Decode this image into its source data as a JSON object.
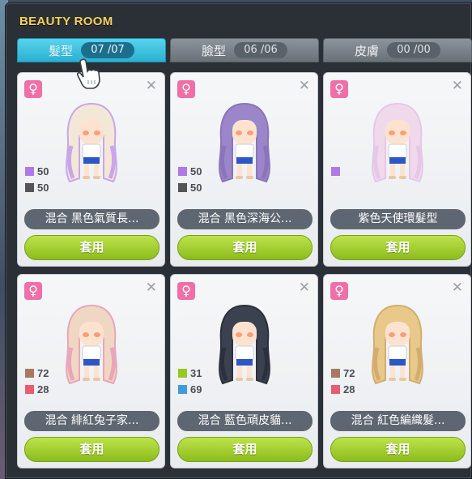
{
  "window": {
    "title": "BEAUTY ROOM"
  },
  "tabs": [
    {
      "label": "髮型",
      "count": "07 /07",
      "active": true
    },
    {
      "label": "臉型",
      "count": "06 /06",
      "active": false
    },
    {
      "label": "皮膚",
      "count": "00 /00",
      "active": false
    }
  ],
  "cards": [
    {
      "gender": "♀",
      "name": "混合 黑色氣質長...",
      "apply": "套用",
      "hair": "#f3e8d8",
      "hair2": "#c9a6ea",
      "mix": [
        {
          "color": "#b07ae6",
          "value": "50"
        },
        {
          "color": "#555555",
          "value": "50"
        }
      ]
    },
    {
      "gender": "♀",
      "name": "混合 黑色深海公...",
      "apply": "套用",
      "hair": "#9b86c9",
      "hair2": "#8a74bb",
      "mix": [
        {
          "color": "#b07ae6",
          "value": "50"
        },
        {
          "color": "#555555",
          "value": "50"
        }
      ]
    },
    {
      "gender": "♀",
      "name": "紫色天使環髮型",
      "apply": "套用",
      "hair": "#f1d9ec",
      "hair2": "#e6c7e8",
      "mix": [
        {
          "color": "#b07ae6",
          "value": ""
        }
      ]
    },
    {
      "gender": "♀",
      "name": "混合 緋紅兔子家...",
      "apply": "套用",
      "hair": "#f0d7c3",
      "hair2": "#e7a6b9",
      "mix": [
        {
          "color": "#a87960",
          "value": "72"
        },
        {
          "color": "#e75d6f",
          "value": "28"
        }
      ]
    },
    {
      "gender": "♀",
      "name": "混合 藍色頑皮貓...",
      "apply": "套用",
      "hair": "#3c4150",
      "hair2": "#2b303c",
      "mix": [
        {
          "color": "#97c81f",
          "value": "31"
        },
        {
          "color": "#3f9be0",
          "value": "69"
        }
      ]
    },
    {
      "gender": "♀",
      "name": "混合 紅色編織髮...",
      "apply": "套用",
      "hair": "#e8c98a",
      "hair2": "#d3ad6e",
      "mix": [
        {
          "color": "#a87960",
          "value": "72"
        },
        {
          "color": "#e75d6f",
          "value": "28"
        }
      ]
    }
  ]
}
